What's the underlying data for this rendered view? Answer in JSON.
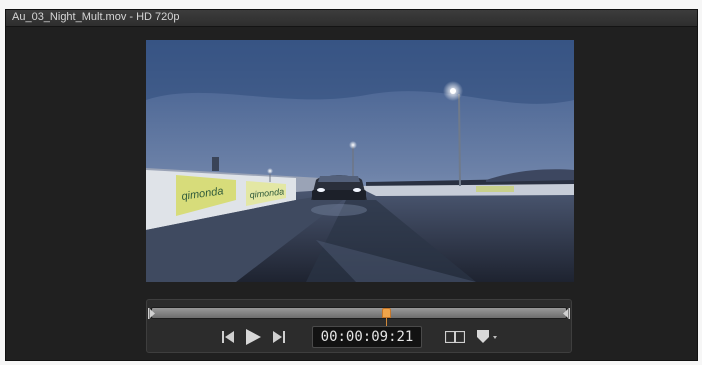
{
  "window": {
    "title": "Au_03_Night_Mult.mov - HD 720p"
  },
  "icons": {
    "in_point": "in-point-icon",
    "out_point": "out-point-icon",
    "previous": "skip-back-icon",
    "play": "play-icon",
    "next": "skip-forward-icon",
    "frame": "frame-icon",
    "marker_menu": "marker-dropdown-icon"
  },
  "transport": {
    "timecode": "00:00:09:21",
    "playhead_fraction": 0.565
  },
  "video": {
    "description_text": "",
    "banner_left_text": "qimonda",
    "banner_right_text": "qimonda"
  },
  "colors": {
    "accent": "#f0a44a",
    "background": "#202020"
  }
}
